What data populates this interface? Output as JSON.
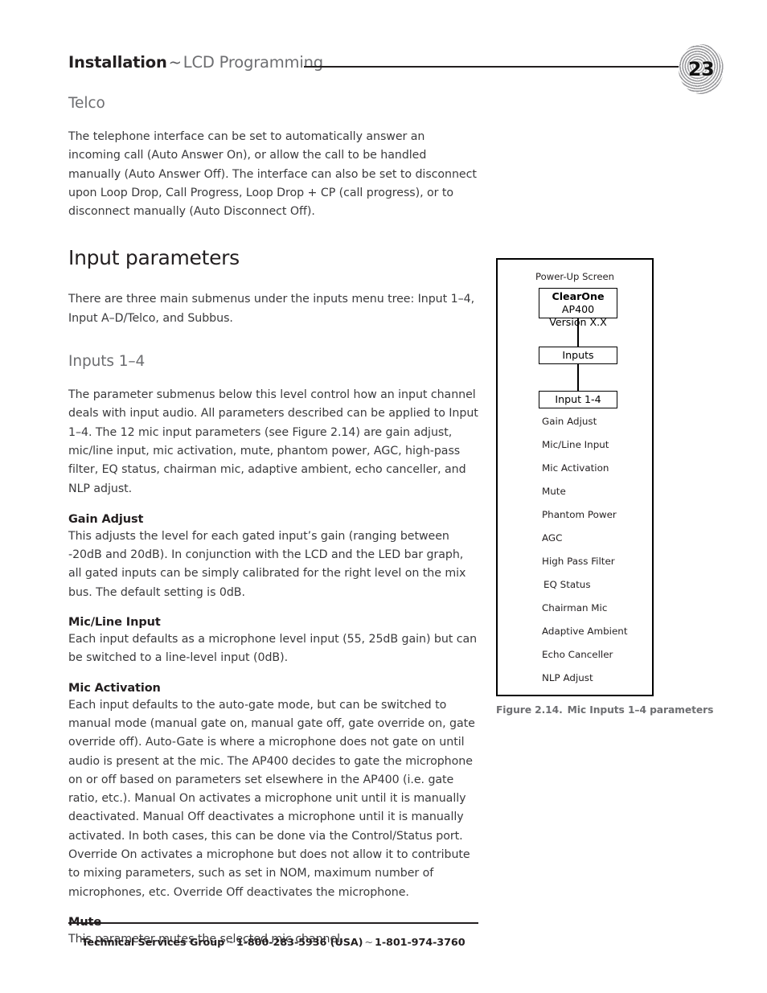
{
  "page": {
    "number": "23",
    "header": {
      "strong": "Installation",
      "tilde": "~",
      "light": "LCD Programming"
    }
  },
  "sections": {
    "telco": {
      "heading": "Telco",
      "paragraph": "The telephone interface can be set to automatically answer an incoming call (Auto Answer On), or allow the call to be handled manually (Auto Answer Off). The interface can also be set to disconnect upon Loop Drop, Call Progress, Loop Drop + CP (call progress), or to disconnect manually (Auto Disconnect Off)."
    },
    "input_parameters": {
      "heading": "Input parameters",
      "paragraph": "There are three main submenus under the inputs menu tree: Input 1–4, Input A–D/Telco, and Subbus."
    },
    "inputs_1_4": {
      "heading": "Inputs 1–4",
      "paragraph": "The parameter submenus below this level control how an input channel deals with input audio. All parameters described can be applied to Input 1–4. The 12 mic input parameters (see Figure 2.14) are gain adjust, mic/line input, mic activation, mute, phantom power, AGC, high-pass filter, EQ status, chairman mic, adaptive ambient, echo canceller, and NLP adjust."
    },
    "gain_adjust": {
      "heading": "Gain Adjust",
      "paragraph": "This adjusts the level for each gated input’s gain (ranging between -20dB and 20dB). In conjunction with the LCD and the LED bar graph, all gated inputs can be simply calibrated for the right level on the mix bus. The default setting is 0dB."
    },
    "mic_line_input": {
      "heading": "Mic/Line Input",
      "paragraph": "Each input defaults as a microphone level input (55, 25dB gain) but can be switched to a line-level input (0dB)."
    },
    "mic_activation": {
      "heading": "Mic Activation",
      "paragraph": "Each input defaults to the auto-gate mode, but can be switched to manual mode (manual gate on, manual gate off, gate override on, gate override off). Auto-Gate is where a microphone does not gate on until audio is present at the mic. The AP400 decides to gate the microphone on or off based on parameters set elsewhere in the AP400 (i.e. gate ratio, etc.). Manual On activates a microphone unit until it is manually deactivated. Manual Off deactivates a microphone until it is manually activated. In both cases, this can be done via the Control/Status port. Override On activates a microphone but does not allow it to contribute to mixing parameters, such as set in NOM, maximum number of microphones, etc. Override Off deactivates the microphone."
    },
    "mute": {
      "heading": "Mute",
      "paragraph": "This parameter mutes the selected mic channel."
    }
  },
  "figure": {
    "top_label": "Power-Up Screen",
    "boxes": [
      {
        "brand": "ClearOne",
        "model": "AP400",
        "line2": "Version X.X"
      },
      {
        "label": "Inputs"
      },
      {
        "label": "Input 1-4"
      }
    ],
    "parameters": [
      "Gain Adjust",
      "Mic/Line Input",
      "Mic Activation",
      "Mute",
      "Phantom Power",
      "AGC",
      "High Pass Filter",
      "EQ Status",
      "Chairman Mic",
      "Adaptive Ambient",
      "Echo Canceller",
      "NLP Adjust"
    ],
    "caption": {
      "number": "Figure 2.14.",
      "title": "Mic Inputs 1–4 parameters"
    }
  },
  "footer": {
    "group": "Technical Services Group",
    "tilde1": "~",
    "phone_usa": "1-800-283-5936 (USA)",
    "tilde2": "~",
    "phone_intl": "1-801-974-3760"
  },
  "colors": {
    "ink": "#231f20",
    "body_ink": "#3a3a3c",
    "gray_heading": "#6d6e71",
    "badge_ring": "#9a9a9d"
  }
}
